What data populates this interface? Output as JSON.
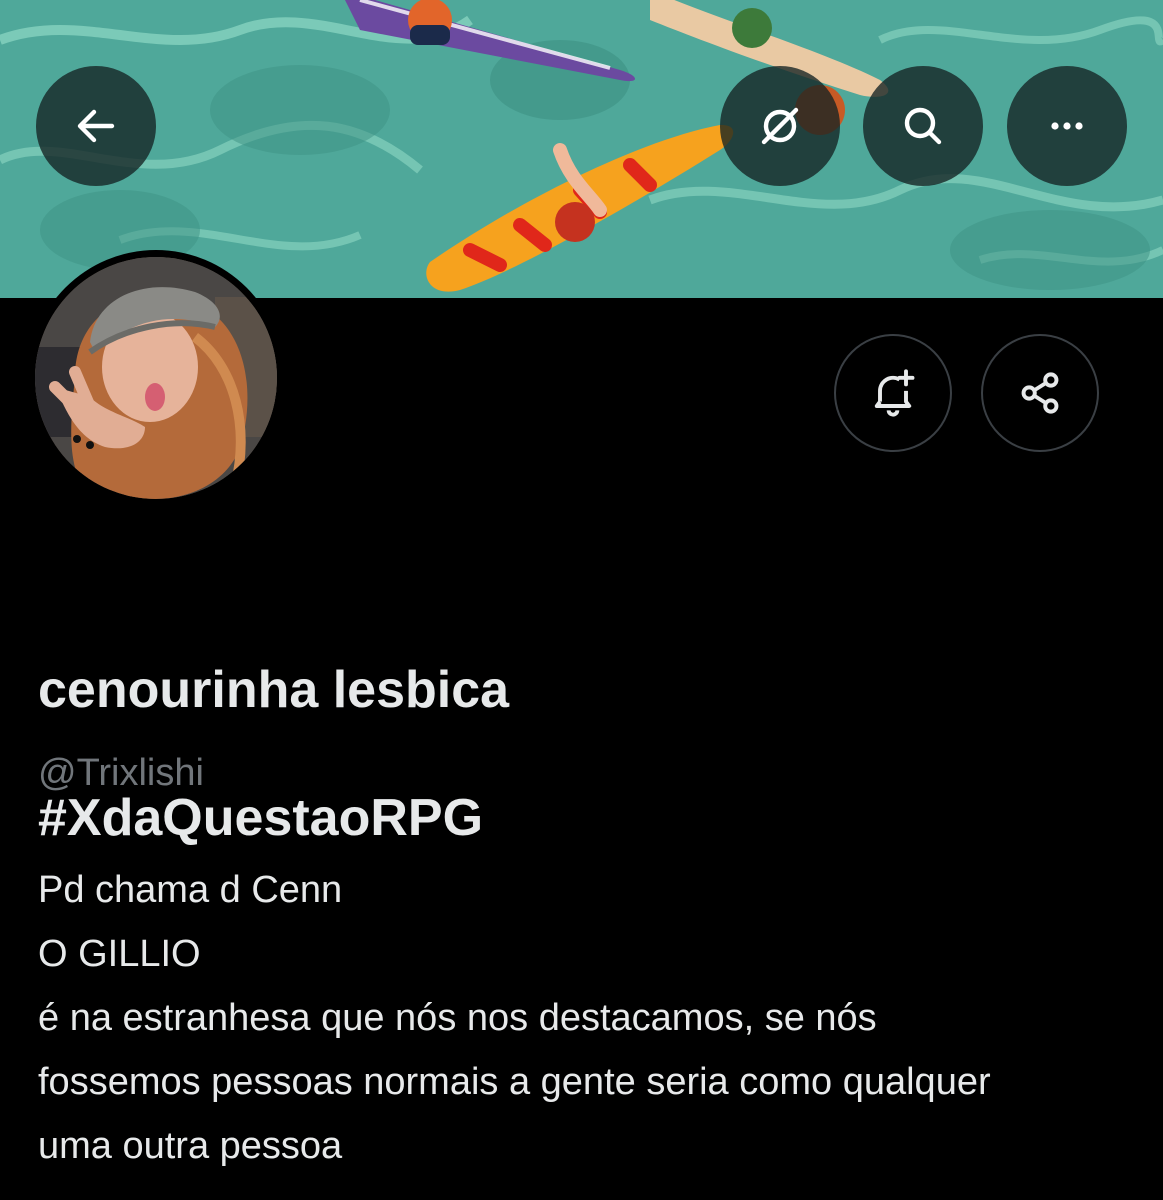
{
  "header": {
    "back_icon": "arrow-left-icon",
    "grok_icon": "grok-slash-icon",
    "search_icon": "search-icon",
    "more_icon": "more-dots-icon",
    "button_bg": "#142323"
  },
  "profile": {
    "display_name": "cenourinha lesbica #XdaQuestaoRPG",
    "display_name_lines": [
      "cenourinha lesbica",
      "#XdaQuestaoRPG"
    ],
    "handle": "@Trixlishi",
    "bio_lines": [
      "Pd chama d Cenn",
      "O GILLIO",
      "é na estranhesa que nós nos destacamos, se nós",
      "fossemos pessoas normais a gente seria como qualquer",
      "uma outra pessoa"
    ]
  },
  "actions": {
    "notify_icon": "bell-plus-icon",
    "share_icon": "share-icon"
  },
  "colors": {
    "background": "#000000",
    "text_primary": "#e7e9ea",
    "text_secondary": "#71767b",
    "button_border": "#3a3f44",
    "banner_water": "#4fa89a"
  }
}
